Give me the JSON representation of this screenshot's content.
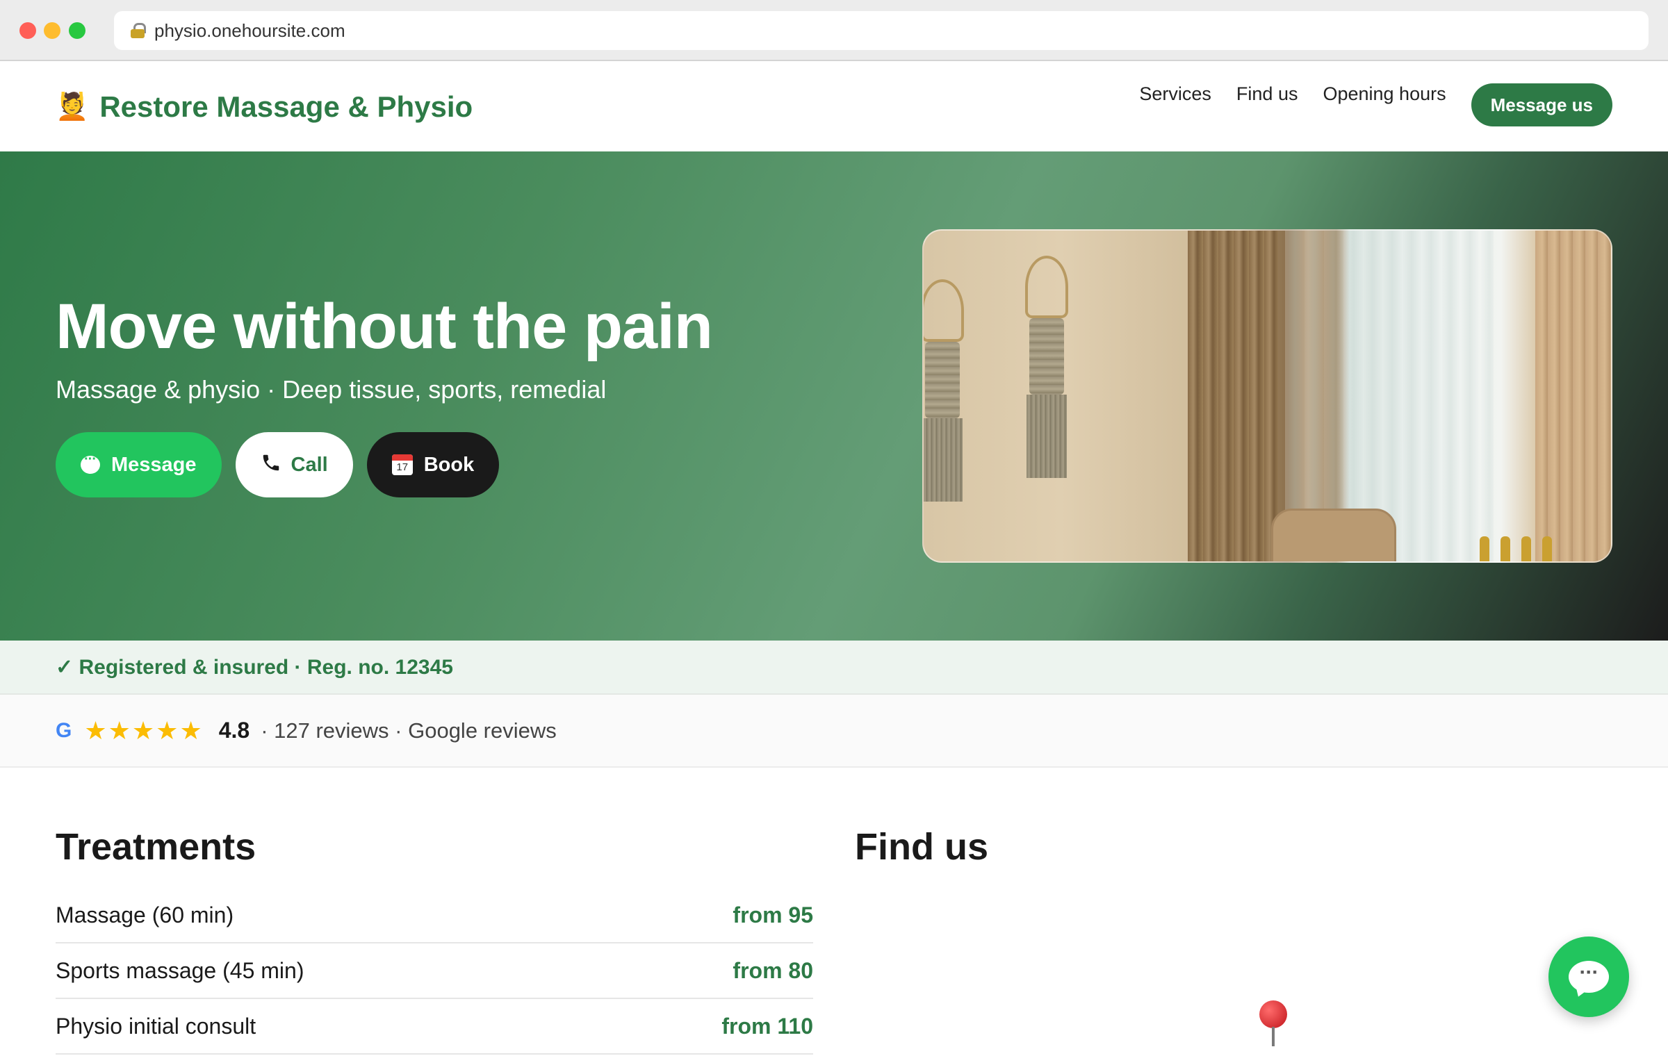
{
  "browser": {
    "url": "physio.onehoursite.com"
  },
  "header": {
    "brand_icon": "💆",
    "brand_name": "Restore Massage & Physio",
    "nav": [
      "Services",
      "Find us",
      "Opening hours"
    ],
    "cta_label": "Message us"
  },
  "hero": {
    "title": "Move without the pain",
    "subtitle": "Massage & physio · Deep tissue, sports, remedial",
    "buttons": {
      "message": "Message",
      "call": "Call",
      "book": "Book"
    },
    "calendar_day": "17"
  },
  "registration": {
    "text": "✓ Registered & insured · Reg. no. 12345"
  },
  "reviews": {
    "provider_logo": "G",
    "stars": "★★★★★",
    "rating": "4.8",
    "meta": "· 127 reviews · Google reviews"
  },
  "treatments": {
    "title": "Treatments",
    "items": [
      {
        "name": "Massage (60 min)",
        "price": "from 95"
      },
      {
        "name": "Sports massage (45 min)",
        "price": "from 80"
      },
      {
        "name": "Physio initial consult",
        "price": "from 110"
      }
    ]
  },
  "find_us": {
    "title": "Find us"
  },
  "colors": {
    "brand_green": "#2d7a46",
    "action_green": "#22c55e",
    "dark": "#1a1a1a",
    "star_yellow": "#fbbc04"
  },
  "icons": {
    "lock": "lock-icon",
    "message": "chat-bubble-icon",
    "call": "phone-icon",
    "book": "calendar-icon",
    "map_pin": "map-pin-icon",
    "chat_fab": "chat-bubble-icon"
  }
}
